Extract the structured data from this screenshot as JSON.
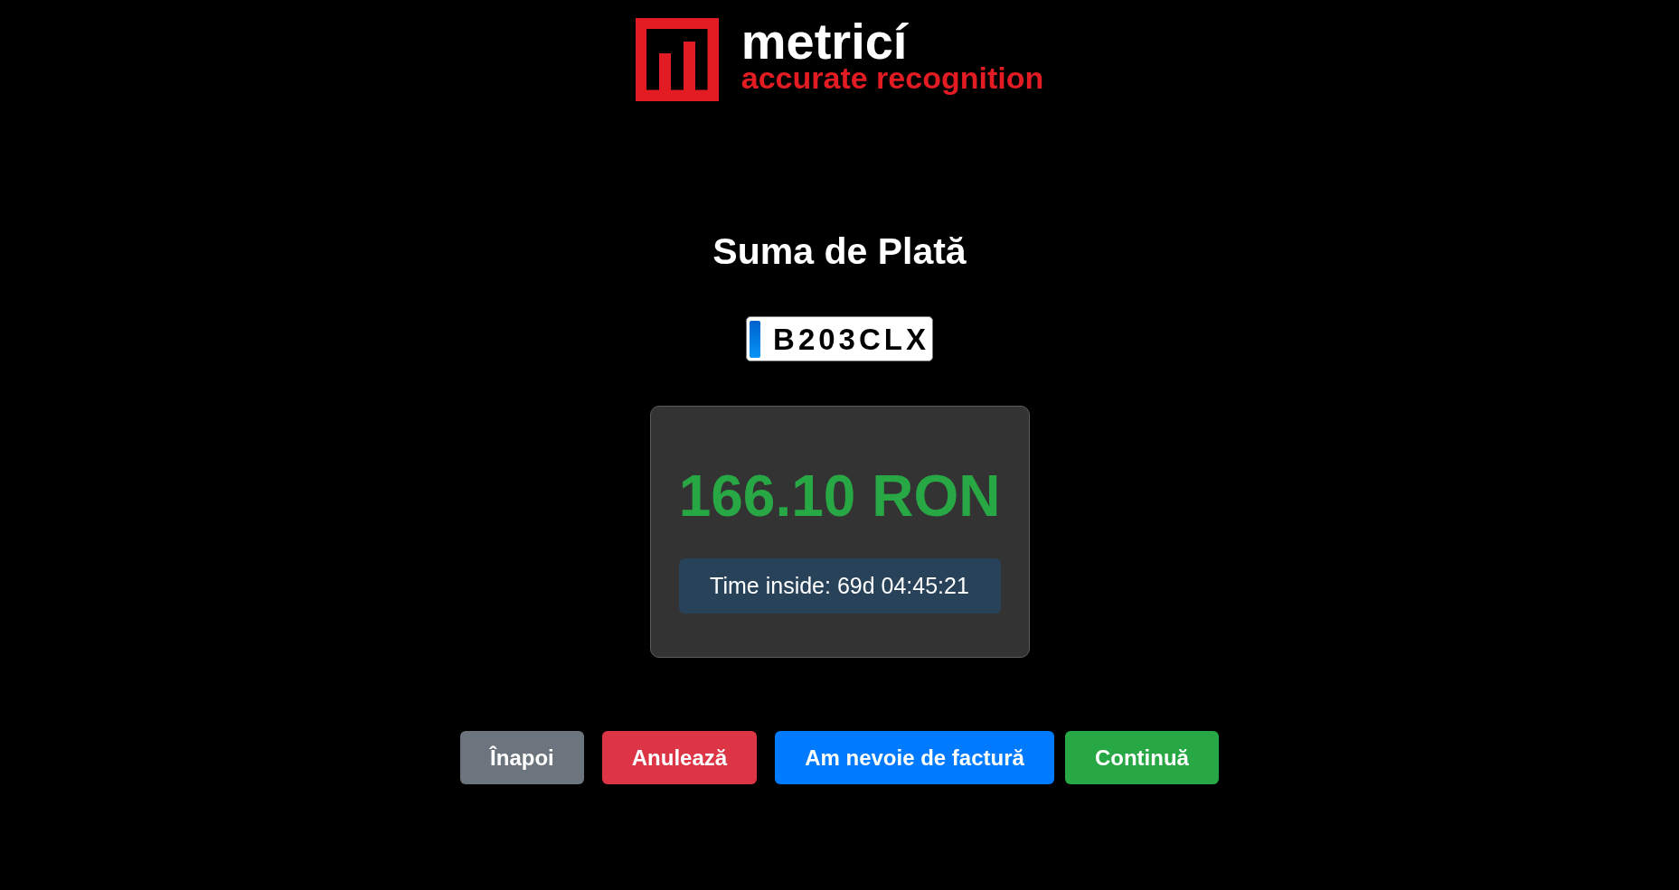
{
  "logo": {
    "name": "metricí",
    "tagline": "accurate recognition"
  },
  "title": "Suma de Plată",
  "plate": {
    "number": "B203CLX"
  },
  "payment": {
    "amount": "166.10 RON",
    "time_inside": "Time inside: 69d 04:45:21"
  },
  "buttons": [
    {
      "label": "Înapoi",
      "kind": "secondary"
    },
    {
      "label": "Anulează",
      "kind": "danger"
    },
    {
      "label": "Am nevoie de factură",
      "kind": "primary"
    },
    {
      "label": "Continuă",
      "kind": "success"
    }
  ]
}
